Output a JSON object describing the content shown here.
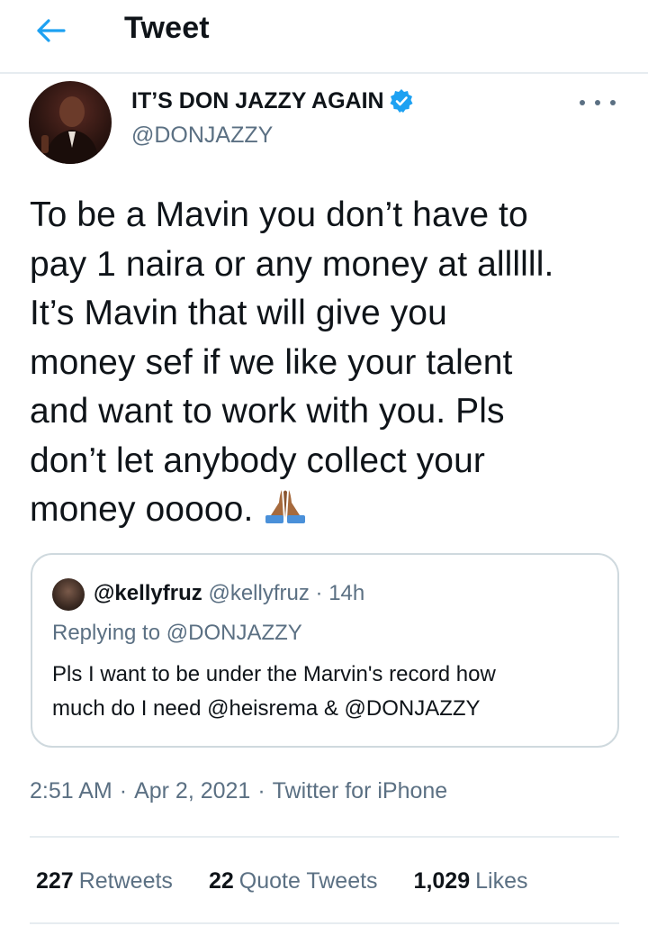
{
  "header": {
    "title": "Tweet",
    "back_icon": "arrow-left-icon",
    "accent": "#1da1f2"
  },
  "tweet": {
    "author": {
      "display_name": "IT’S DON JAZZY AGAIN",
      "handle": "@DONJAZZY",
      "verified": true
    },
    "text_lines": [
      "To be a Mavin you don’t have to",
      "pay 1 naira or any money at allllll.",
      "It’s Mavin that will give you",
      "money sef if we like your talent",
      "and want to work with you. Pls",
      "don’t let anybody collect your",
      "money ooooo."
    ],
    "emoji": "folded-hands-emoji"
  },
  "quoted": {
    "name": "@kellyfruz",
    "handle": "@kellyfruz",
    "separator": "·",
    "time": "14h",
    "replying_prefix": "Replying to",
    "replying_to": "@DONJAZZY",
    "text_line1": "Pls I want to be under the Marvin's record how",
    "text_line2": "much do I need @heisrema & @DONJAZZY"
  },
  "meta": {
    "time": "2:51 AM",
    "separator": "·",
    "date": "Apr 2, 2021",
    "source": "Twitter for iPhone"
  },
  "stats": {
    "retweets": {
      "count": "227",
      "label": "Retweets"
    },
    "quotes": {
      "count": "22",
      "label": "Quote Tweets"
    },
    "likes": {
      "count": "1,029",
      "label": "Likes"
    }
  },
  "colors": {
    "text_primary": "#0f1419",
    "text_secondary": "#5b7083",
    "border": "#e6ecf0",
    "verified_badge": "#1da1f2"
  }
}
